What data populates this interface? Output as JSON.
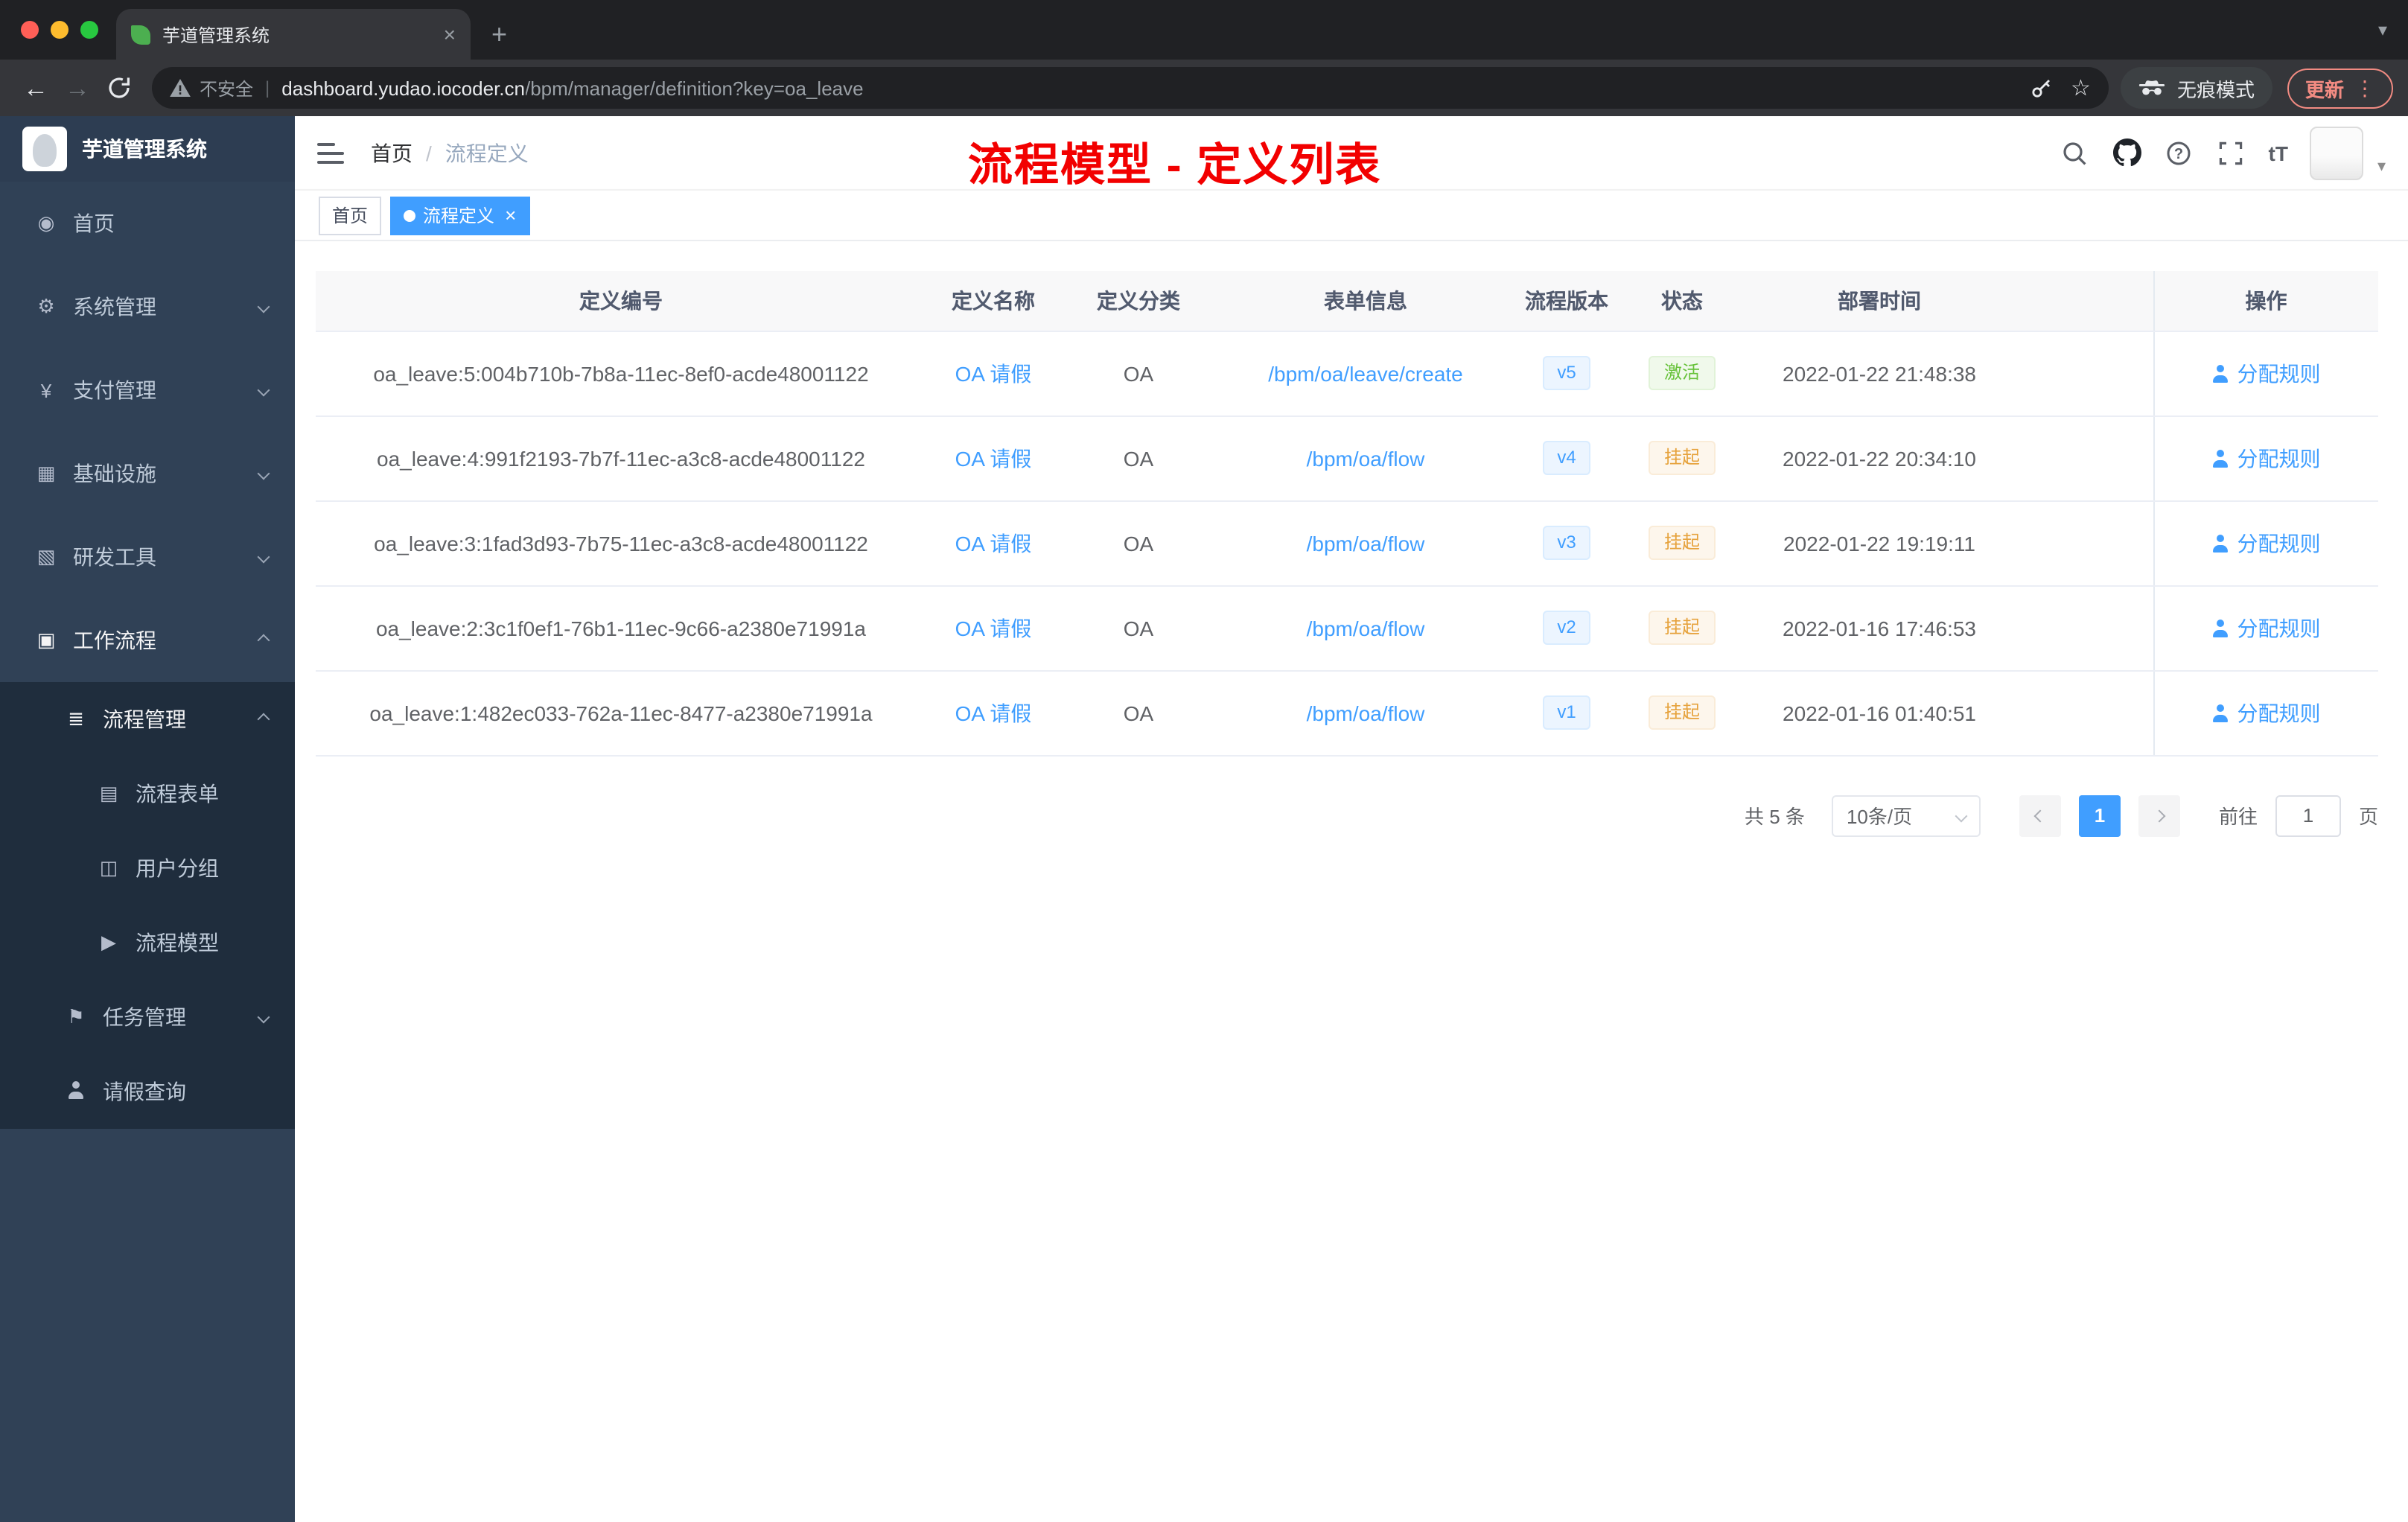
{
  "browser": {
    "tab_title": "芋道管理系统",
    "security_label": "不安全",
    "url_host": "dashboard.yudao.iocoder.cn",
    "url_path": "/bpm/manager/definition?key=oa_leave",
    "incognito_label": "无痕模式",
    "update_label": "更新"
  },
  "icons": {
    "close_tab": "×",
    "new_tab": "+",
    "caret_down": "▾",
    "back_arrow": "←",
    "forward_arrow": "→",
    "star": "☆",
    "kebab": "⋮",
    "url_divider": "|",
    "breadcrumb_separator": "/",
    "font_size": "tT",
    "home": "◉",
    "gear": "⚙",
    "yen": "¥",
    "infrastructure": "▦",
    "tools": "▧",
    "workflow": "▣",
    "list": "≣",
    "form": "▤",
    "group": "◫",
    "model": "▶",
    "flag": "⚑",
    "tag_close": "×"
  },
  "sidebar": {
    "app_title": "芋道管理系统",
    "items": [
      {
        "label": "首页"
      },
      {
        "label": "系统管理"
      },
      {
        "label": "支付管理"
      },
      {
        "label": "基础设施"
      },
      {
        "label": "研发工具"
      },
      {
        "label": "工作流程"
      },
      {
        "label": "流程管理"
      },
      {
        "label": "流程表单"
      },
      {
        "label": "用户分组"
      },
      {
        "label": "流程模型"
      },
      {
        "label": "任务管理"
      },
      {
        "label": "请假查询"
      }
    ]
  },
  "header": {
    "breadcrumb_home": "首页",
    "breadcrumb_current": "流程定义",
    "annotation": "流程模型 - 定义列表"
  },
  "tags": {
    "home": "首页",
    "current": "流程定义"
  },
  "table": {
    "columns": [
      "定义编号",
      "定义名称",
      "定义分类",
      "表单信息",
      "流程版本",
      "状态",
      "部署时间",
      "操作"
    ],
    "rows": [
      {
        "id": "oa_leave:5:004b710b-7b8a-11ec-8ef0-acde48001122",
        "name": "OA 请假",
        "category": "OA",
        "form": "/bpm/oa/leave/create",
        "version": "v5",
        "status": "激活",
        "time": "2022-01-22 21:48:38",
        "action": "分配规则"
      },
      {
        "id": "oa_leave:4:991f2193-7b7f-11ec-a3c8-acde48001122",
        "name": "OA 请假",
        "category": "OA",
        "form": "/bpm/oa/flow",
        "version": "v4",
        "status": "挂起",
        "time": "2022-01-22 20:34:10",
        "action": "分配规则"
      },
      {
        "id": "oa_leave:3:1fad3d93-7b75-11ec-a3c8-acde48001122",
        "name": "OA 请假",
        "category": "OA",
        "form": "/bpm/oa/flow",
        "version": "v3",
        "status": "挂起",
        "time": "2022-01-22 19:19:11",
        "action": "分配规则"
      },
      {
        "id": "oa_leave:2:3c1f0ef1-76b1-11ec-9c66-a2380e71991a",
        "name": "OA 请假",
        "category": "OA",
        "form": "/bpm/oa/flow",
        "version": "v2",
        "status": "挂起",
        "time": "2022-01-16 17:46:53",
        "action": "分配规则"
      },
      {
        "id": "oa_leave:1:482ec033-762a-11ec-8477-a2380e71991a",
        "name": "OA 请假",
        "category": "OA",
        "form": "/bpm/oa/flow",
        "version": "v1",
        "status": "挂起",
        "time": "2022-01-16 01:40:51",
        "action": "分配规则"
      }
    ]
  },
  "pagination": {
    "total": "共 5 条",
    "page_size": "10条/页",
    "page": "1",
    "goto_label": "前往",
    "goto_value": "1",
    "unit_label": "页"
  },
  "colors": {
    "accent_blue": "#409eff",
    "success_green": "#67c23a",
    "warning_yellow": "#e6a23c",
    "annotation_red": "#f20000",
    "sidebar_bg": "#304156",
    "submenu_bg": "#1f2d3d"
  }
}
